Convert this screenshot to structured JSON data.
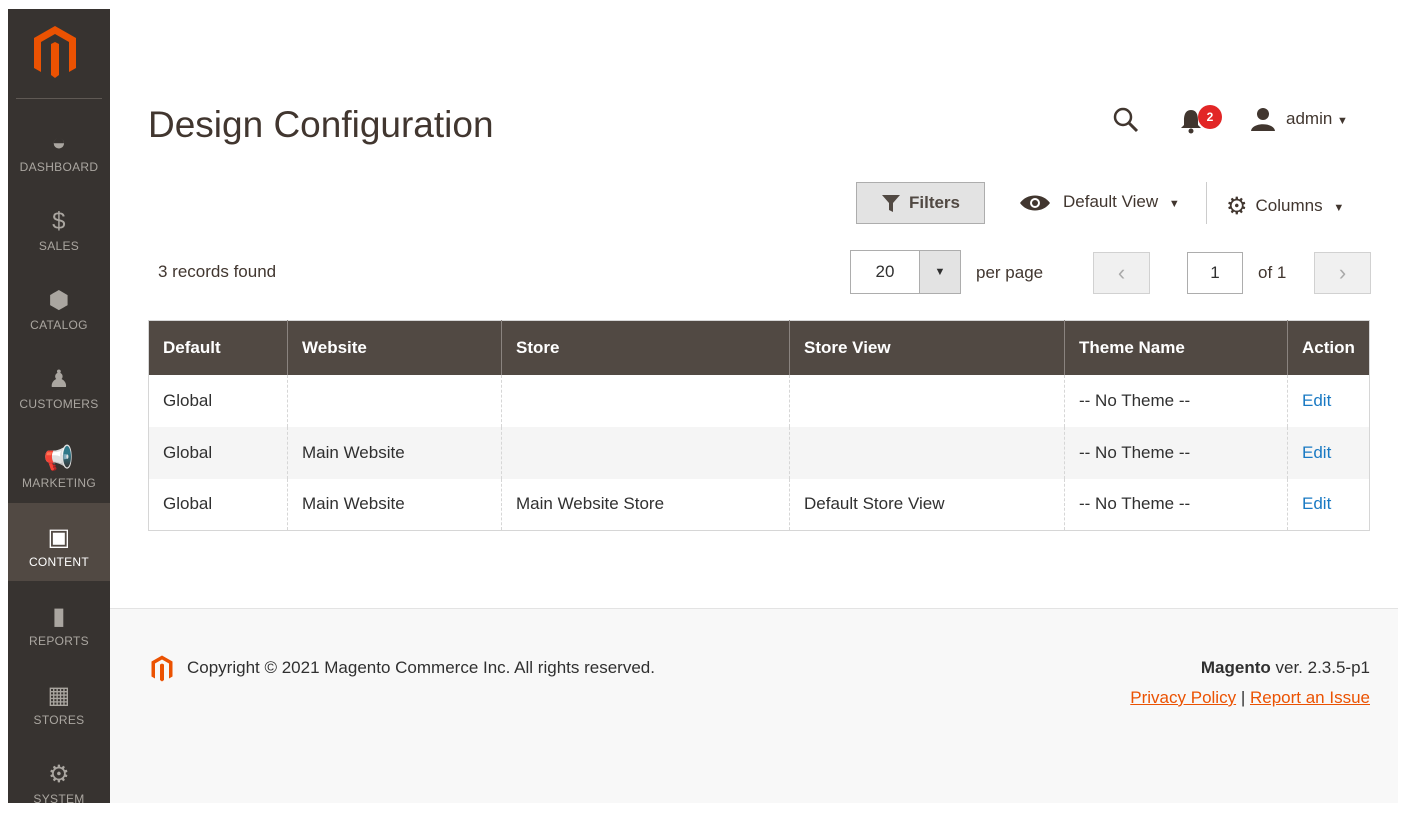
{
  "sidebar": {
    "items": [
      {
        "label": "DASHBOARD",
        "icon": "dashboard-icon"
      },
      {
        "label": "SALES",
        "icon": "dollar-icon"
      },
      {
        "label": "CATALOG",
        "icon": "box-icon"
      },
      {
        "label": "CUSTOMERS",
        "icon": "person-icon"
      },
      {
        "label": "MARKETING",
        "icon": "megaphone-icon"
      },
      {
        "label": "CONTENT",
        "icon": "layout-icon",
        "active": true
      },
      {
        "label": "REPORTS",
        "icon": "bar-chart-icon"
      },
      {
        "label": "STORES",
        "icon": "store-icon"
      },
      {
        "label": "SYSTEM",
        "icon": "gear-icon"
      }
    ]
  },
  "header": {
    "title": "Design Configuration",
    "notifications": "2",
    "user": "admin"
  },
  "toolbar": {
    "filters": "Filters",
    "view": "Default View",
    "columns": "Columns"
  },
  "grid": {
    "records": "3 records found",
    "per_page_value": "20",
    "per_page_label": "per page",
    "page": "1",
    "of_pages": "of 1",
    "columns": [
      "Default",
      "Website",
      "Store",
      "Store View",
      "Theme Name",
      "Action"
    ],
    "rows": [
      [
        "Global",
        "",
        "",
        "",
        "-- No Theme --",
        "Edit"
      ],
      [
        "Global",
        "Main Website",
        "",
        "",
        "-- No Theme --",
        "Edit"
      ],
      [
        "Global",
        "Main Website",
        "Main Website Store",
        "Default Store View",
        "-- No Theme --",
        "Edit"
      ]
    ]
  },
  "footer": {
    "copyright": "Copyright © 2021 Magento Commerce Inc. All rights reserved.",
    "brand": "Magento",
    "version": " ver. 2.3.5-p1",
    "privacy": "Privacy Policy",
    "separator": "|",
    "report": "Report an Issue"
  },
  "colors": {
    "sidebar": "#373330",
    "accent": "#eb5202",
    "header": "#514943",
    "link": "#1979c3"
  }
}
